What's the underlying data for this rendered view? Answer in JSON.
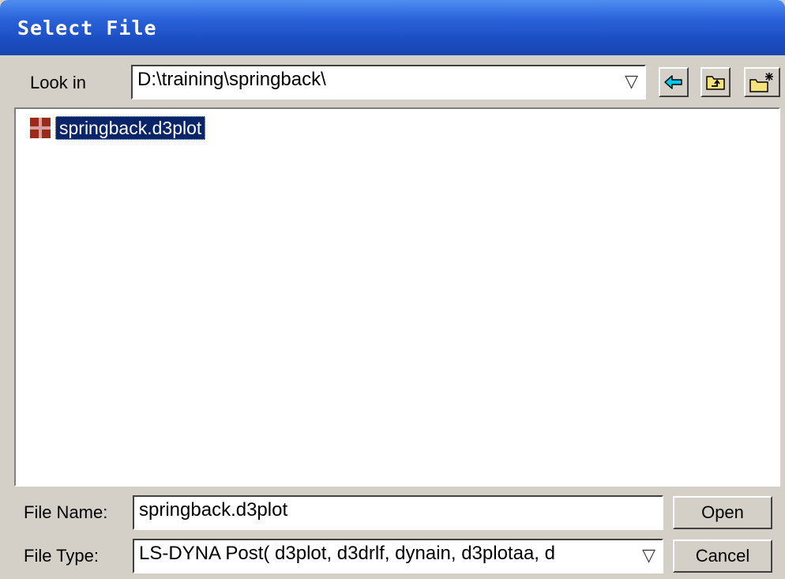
{
  "window": {
    "title": "Select File"
  },
  "look_in": {
    "label": "Look in",
    "value": "D:\\training\\springback\\",
    "dropdown_glyph": "▽"
  },
  "toolbar": {
    "back_icon": "back-arrow-icon",
    "up_icon": "up-folder-icon",
    "new_folder_icon": "new-folder-icon",
    "back_color": "#00c8e8"
  },
  "files": [
    {
      "name": "springback.d3plot",
      "icon": "d3plot-file-icon",
      "selected": true
    }
  ],
  "file_name": {
    "label": "File Name:",
    "value": "springback.d3plot"
  },
  "file_type": {
    "label": "File Type:",
    "value": "LS-DYNA Post( d3plot, d3drlf, dynain, d3plotaa, d",
    "dropdown_glyph": "▽"
  },
  "buttons": {
    "open": "Open",
    "cancel": "Cancel"
  },
  "colors": {
    "title_bar": "#2a62d9",
    "selection": "#0a246a",
    "face": "#d4d0c8"
  }
}
